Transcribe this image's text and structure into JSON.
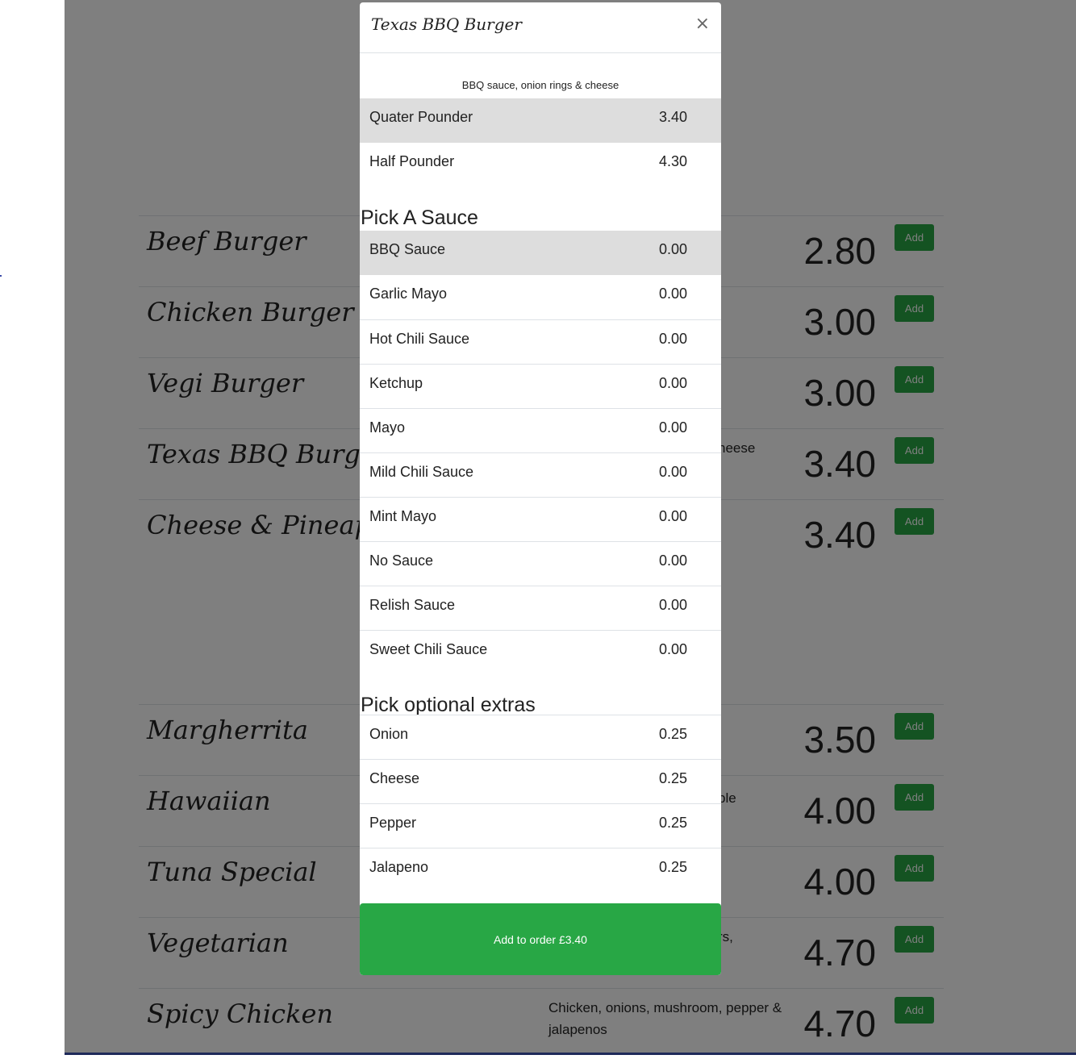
{
  "menu": {
    "items": [
      {
        "name": "Beef Burger",
        "desc": "",
        "price": "2.80",
        "add_label": "Add"
      },
      {
        "name": "Chicken Burger",
        "desc": "",
        "price": "3.00",
        "add_label": "Add"
      },
      {
        "name": "Vegi Burger",
        "desc": "",
        "price": "3.00",
        "add_label": "Add"
      },
      {
        "name": "Texas BBQ Burger",
        "desc": "heese",
        "price": "3.40",
        "add_label": "Add"
      },
      {
        "name": "Cheese & Pineapple",
        "desc": "",
        "price": "3.40",
        "add_label": "Add"
      },
      {
        "name": "Margherrita",
        "desc": "",
        "price": "3.50",
        "add_label": "Add"
      },
      {
        "name": "Hawaiian",
        "desc": "ple",
        "price": "4.00",
        "add_label": "Add"
      },
      {
        "name": "Tuna Special",
        "desc": "",
        "price": "4.00",
        "add_label": "Add"
      },
      {
        "name": "Vegetarian",
        "desc": "rs,",
        "price": "4.70",
        "add_label": "Add"
      },
      {
        "name": "Spicy Chicken",
        "desc": "Chicken, onions, mushroom, pepper & jalapenos",
        "price": "4.70",
        "add_label": "Add"
      }
    ]
  },
  "modal": {
    "title": "Texas BBQ Burger",
    "close_symbol": "×",
    "description": "BBQ sauce, onion rings & cheese",
    "sizes": [
      {
        "label": "Quater Pounder",
        "price": "3.40",
        "selected": true
      },
      {
        "label": "Half Pounder",
        "price": "4.30",
        "selected": false
      }
    ],
    "sauce_title": "Pick A Sauce",
    "sauces": [
      {
        "label": "BBQ Sauce",
        "price": "0.00",
        "selected": true
      },
      {
        "label": "Garlic Mayo",
        "price": "0.00",
        "selected": false
      },
      {
        "label": "Hot Chili Sauce",
        "price": "0.00",
        "selected": false
      },
      {
        "label": "Ketchup",
        "price": "0.00",
        "selected": false
      },
      {
        "label": "Mayo",
        "price": "0.00",
        "selected": false
      },
      {
        "label": "Mild Chili Sauce",
        "price": "0.00",
        "selected": false
      },
      {
        "label": "Mint Mayo",
        "price": "0.00",
        "selected": false
      },
      {
        "label": "No Sauce",
        "price": "0.00",
        "selected": false
      },
      {
        "label": "Relish Sauce",
        "price": "0.00",
        "selected": false
      },
      {
        "label": "Sweet Chili Sauce",
        "price": "0.00",
        "selected": false
      }
    ],
    "extras_title": "Pick optional extras",
    "extras": [
      {
        "label": "Onion",
        "price": "0.25",
        "selected": false
      },
      {
        "label": "Cheese",
        "price": "0.25",
        "selected": false
      },
      {
        "label": "Pepper",
        "price": "0.25",
        "selected": false
      },
      {
        "label": "Jalapeno",
        "price": "0.25",
        "selected": false
      }
    ],
    "submit_label": "Add to order £3.40"
  },
  "colors": {
    "accent": "#28a745",
    "overlay": "#808080",
    "selected_row": "#dddddd"
  }
}
